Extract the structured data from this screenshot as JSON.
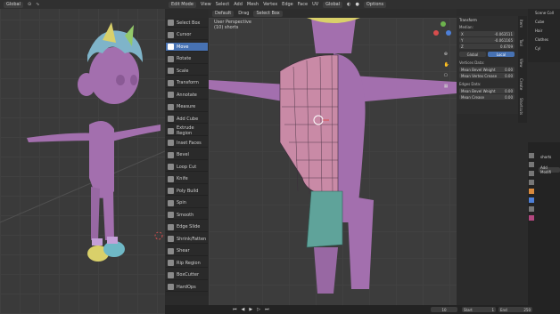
{
  "header": {
    "mode": "Edit Mode",
    "view": "View",
    "select": "Select",
    "add": "Add",
    "mesh": "Mesh",
    "vertex": "Vertex",
    "edge": "Edge",
    "face": "Face",
    "uv": "UV",
    "orientation": "Default",
    "drag": "Drag",
    "select_box": "Select Box",
    "global_left": "Global",
    "global_right": "Global",
    "options": "Options"
  },
  "viewport": {
    "title": "User Perspective",
    "subtitle": "(10) shorts"
  },
  "tools": [
    {
      "label": "Select Box"
    },
    {
      "label": "Cursor"
    },
    {
      "label": "Move"
    },
    {
      "label": "Rotate"
    },
    {
      "label": "Scale"
    },
    {
      "label": "Transform"
    },
    {
      "label": "Annotate"
    },
    {
      "label": "Measure"
    },
    {
      "label": "Add Cube"
    },
    {
      "label": "Extrude Region"
    },
    {
      "label": "Inset Faces"
    },
    {
      "label": "Bevel"
    },
    {
      "label": "Loop Cut"
    },
    {
      "label": "Knife"
    },
    {
      "label": "Poly Build"
    },
    {
      "label": "Spin"
    },
    {
      "label": "Smooth"
    },
    {
      "label": "Edge Slide"
    },
    {
      "label": "Shrink/Fatten"
    },
    {
      "label": "Shear"
    },
    {
      "label": "Rip Region"
    },
    {
      "label": "BoxCutter"
    },
    {
      "label": "HardOps"
    }
  ],
  "npanel": {
    "title": "Transform",
    "median": "Median:",
    "x_label": "X",
    "x_value": "-0.063511",
    "y_label": "Y",
    "y_value": "-0.061165",
    "z_label": "Z",
    "z_value": "0.6709",
    "global_btn": "Global",
    "local_btn": "Local",
    "vertices_data": "Vertices Data:",
    "mean_bevel_weight_v": "Mean Bevel Weight",
    "mean_bevel_weight_v_val": "0.00",
    "mean_vertex_crease": "Mean Vertex Crease",
    "mean_vertex_crease_val": "0.00",
    "edges_data": "Edges Data:",
    "mean_bevel_weight_e": "Mean Bevel Weight",
    "mean_bevel_weight_e_val": "0.00",
    "mean_crease": "Mean Crease",
    "mean_crease_val": "0.00"
  },
  "side_tabs": [
    "Item",
    "Tool",
    "View",
    "Create",
    "Shortcuts"
  ],
  "outliner": {
    "items": [
      "Scene Coll",
      "Cube",
      "Hair",
      "Clothes",
      "Cyl"
    ]
  },
  "props": {
    "object_name": "shorts",
    "add_modifier": "Add Modifi"
  },
  "statusbar": {
    "current_frame": "10",
    "start_label": "Start",
    "start_value": "1",
    "end_label": "End",
    "end_value": "250"
  },
  "colors": {
    "skin": "#a36fae",
    "shirt_mesh": "#c98aa6",
    "shorts": "#5fa39a",
    "active_tool": "#4772b3",
    "axis_x": "#d74d4d",
    "axis_y": "#6db34d",
    "axis_z": "#4d7fd7"
  }
}
